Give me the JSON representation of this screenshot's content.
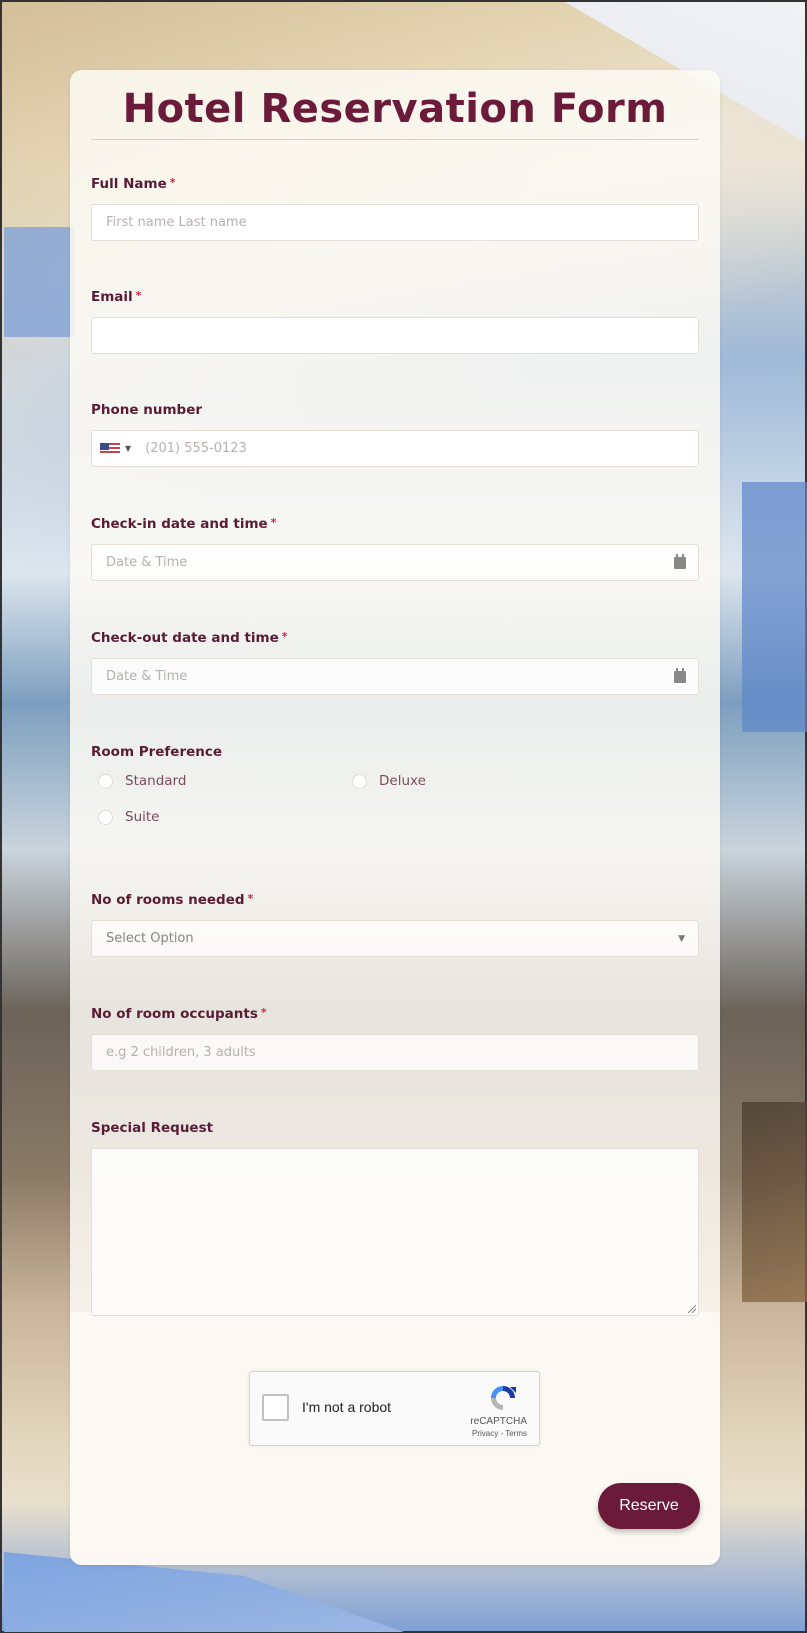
{
  "form": {
    "title": "Hotel Reservation Form",
    "required_mark": "*",
    "fields": {
      "full_name": {
        "label": "Full Name",
        "placeholder": "First name Last name",
        "required": true
      },
      "email": {
        "label": "Email",
        "placeholder": "",
        "required": true
      },
      "phone": {
        "label": "Phone number",
        "placeholder": "(201) 555-0123",
        "country": "US",
        "country_caret": "▼"
      },
      "checkin": {
        "label": "Check-in date and time",
        "placeholder": "Date & Time",
        "required": true,
        "icon": "calendar-icon"
      },
      "checkout": {
        "label": "Check-out date and time",
        "placeholder": "Date & Time",
        "required": true,
        "icon": "calendar-icon"
      },
      "room_preference": {
        "label": "Room Preference",
        "options": [
          "Standard",
          "Deluxe",
          "Suite"
        ]
      },
      "rooms_needed": {
        "label": "No of rooms needed",
        "placeholder": "Select Option",
        "required": true,
        "caret": "▼"
      },
      "occupants": {
        "label": "No of room occupants",
        "placeholder": "e.g 2 children, 3 adults",
        "required": true
      },
      "special_request": {
        "label": "Special Request",
        "placeholder": ""
      }
    },
    "recaptcha": {
      "label": "I'm not a robot",
      "brand": "reCAPTCHA",
      "privacy": "Privacy",
      "separator": " - ",
      "terms": "Terms"
    },
    "submit_label": "Reserve"
  },
  "colors": {
    "accent": "#6b1a3a",
    "required": "#d0263f",
    "label": "#5a1c35"
  }
}
